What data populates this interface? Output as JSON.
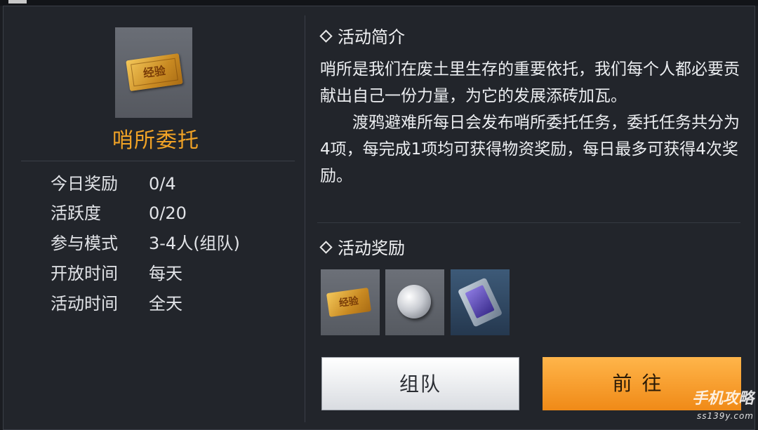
{
  "event": {
    "title": "哨所委托",
    "icon_text": "经验"
  },
  "info": [
    {
      "label": "今日奖励",
      "value": "0/4"
    },
    {
      "label": "活跃度",
      "value": "0/20"
    },
    {
      "label": "参与模式",
      "value": "3-4人(组队)"
    },
    {
      "label": "开放时间",
      "value": "每天"
    },
    {
      "label": "活动时间",
      "value": "全天"
    }
  ],
  "intro": {
    "heading": "活动简介",
    "paragraph1": "哨所是我们在废土里生存的重要依托，我们每个人都必要贡献出自己一份力量，为它的发展添砖加瓦。",
    "paragraph2": "渡鸦避难所每日会发布哨所委托任务，委托任务共分为4项，每完成1项均可获得物资奖励，每日最多可获得4次奖励。"
  },
  "rewards": {
    "heading": "活动奖励",
    "items": [
      {
        "icon": "exp-ticket-icon",
        "text": "经验"
      },
      {
        "icon": "silver-coin-icon"
      },
      {
        "icon": "supply-crate-icon"
      }
    ]
  },
  "buttons": {
    "team": "组队",
    "go": "前往"
  },
  "watermark": {
    "main": "手机攻略",
    "sub": "ss139y.com"
  },
  "colors": {
    "title": "#f0a226",
    "go_button": "#f08a17"
  }
}
